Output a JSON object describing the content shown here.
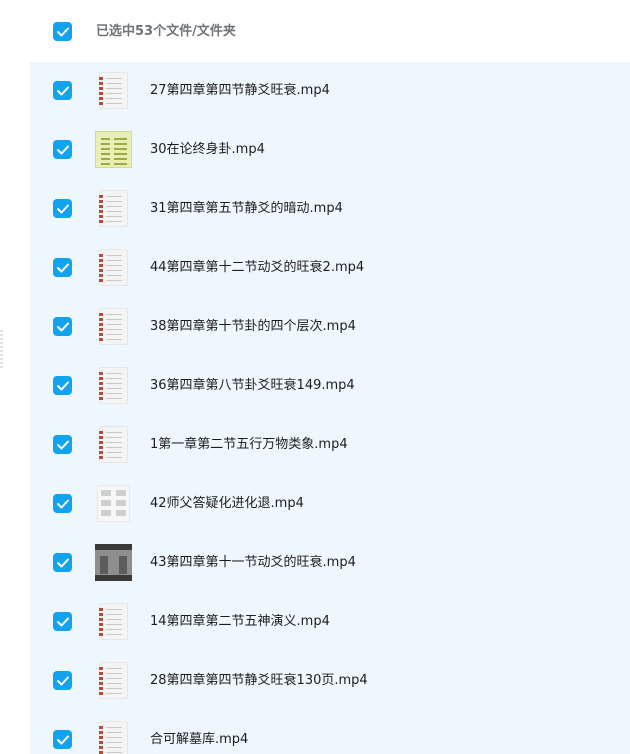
{
  "header": {
    "title": "已选中53个文件/文件夹"
  },
  "accent_color": "#11a3ee",
  "files": [
    {
      "name": "27第四章第四节静爻旺衰.mp4",
      "thumb": "doc-thumbnail"
    },
    {
      "name": "30在论终身卦.mp4",
      "thumb": "green-thumbnail"
    },
    {
      "name": "31第四章第五节静爻的暗动.mp4",
      "thumb": "doc-thumbnail"
    },
    {
      "name": "44第四章第十二节动爻的旺衰2.mp4",
      "thumb": "doc-thumbnail"
    },
    {
      "name": "38第四章第十节卦的四个层次.mp4",
      "thumb": "doc-thumbnail"
    },
    {
      "name": "36第四章第八节卦爻旺衰149.mp4",
      "thumb": "doc-thumbnail"
    },
    {
      "name": "1第一章第二节五行万物类象.mp4",
      "thumb": "doc-thumbnail"
    },
    {
      "name": "42师父答疑化进化退.mp4",
      "thumb": "sheet-thumbnail"
    },
    {
      "name": "43第四章第十一节动爻的旺衰.mp4",
      "thumb": "video-thumbnail"
    },
    {
      "name": "14第四章第二节五神演义.mp4",
      "thumb": "doc-thumbnail"
    },
    {
      "name": "28第四章第四节静爻旺衰130页.mp4",
      "thumb": "doc-thumbnail"
    },
    {
      "name": "合可解墓库.mp4",
      "thumb": "doc-thumbnail"
    }
  ]
}
